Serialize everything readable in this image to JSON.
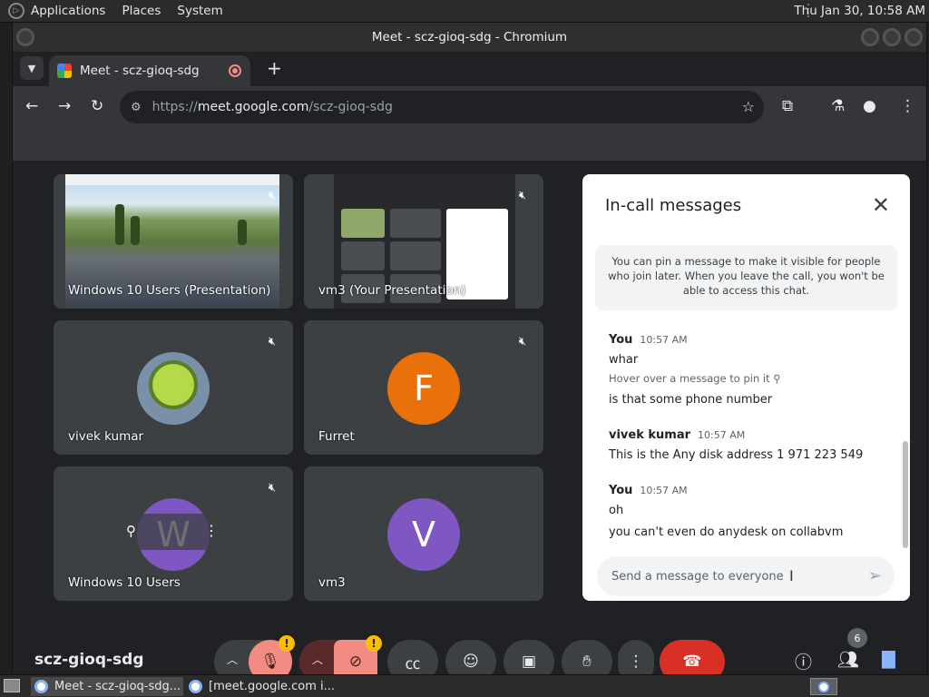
{
  "system": {
    "menus": [
      "Applications",
      "Places",
      "System"
    ],
    "clock": "Thu Jan 30, 10:58 AM"
  },
  "window": {
    "title": "Meet - scz-gioq-sdg - Chromium"
  },
  "tab": {
    "title": "Meet - scz-gioq-sdg"
  },
  "omnibox": {
    "url_prefix": "https://",
    "host": "meet.google.com",
    "path": "/scz-gioq-sdg"
  },
  "tiles": [
    {
      "name": "Windows 10 Users (Presentation)"
    },
    {
      "name": "vm3 (Your Presentation)"
    },
    {
      "name": "vivek kumar"
    },
    {
      "name": "Furret",
      "initial": "F",
      "color": "#e8710a"
    },
    {
      "name": "Windows 10 Users",
      "initial": "W",
      "color": "#7e57c2"
    },
    {
      "name": "vm3",
      "initial": "V",
      "color": "#7e57c2"
    }
  ],
  "chat": {
    "title": "In-call messages",
    "notice": "You can pin a message to make it visible for people who join later. When you leave the call, you won't be able to access this chat.",
    "groups": [
      {
        "sender": "You",
        "time": "10:57 AM",
        "messages": [
          "whar",
          "is that some phone number"
        ],
        "hint": "Hover over a message to pin it"
      },
      {
        "sender": "vivek kumar",
        "time": "10:57 AM",
        "messages": [
          "This is the Any disk address 1 971 223 549"
        ]
      },
      {
        "sender": "You",
        "time": "10:57 AM",
        "messages": [
          "oh",
          "you can't even do anydesk on collabvm"
        ]
      }
    ],
    "placeholder": "Send a message to everyone"
  },
  "controls": {
    "meeting_code": "scz-gioq-sdg",
    "people_count": "6",
    "warn_symbol": "!"
  },
  "taskbar": {
    "items": [
      "Meet - scz-gioq-sdg...",
      "[meet.google.com i..."
    ]
  },
  "colors": {
    "end_call": "#d93025",
    "muted_red": "#f28b82",
    "chat_accent": "#8ab4f8"
  }
}
